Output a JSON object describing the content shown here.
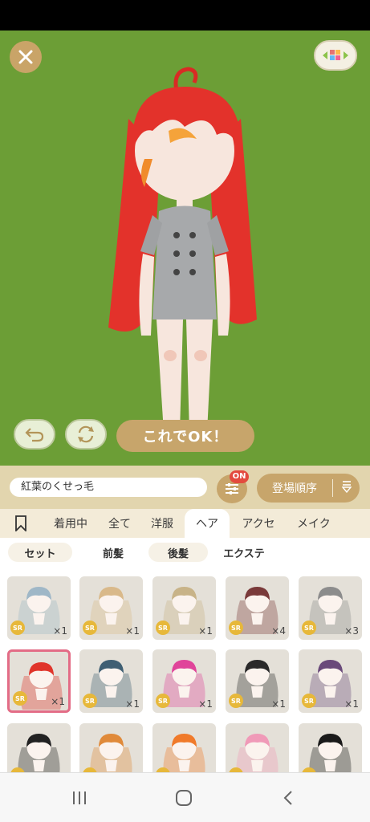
{
  "controls": {
    "ok_label": "これでOK！"
  },
  "item_name": "紅葉のくせっ毛",
  "filter_badge": "ON",
  "sort_label": "登場順序",
  "tabs": [
    {
      "label": "",
      "icon": "bookmark-icon"
    },
    {
      "label": "着用中"
    },
    {
      "label": "全て"
    },
    {
      "label": "洋服"
    },
    {
      "label": "ヘア",
      "active": true
    },
    {
      "label": "アクセ"
    },
    {
      "label": "メイク"
    }
  ],
  "subtabs": [
    {
      "label": "セット"
    },
    {
      "label": "前髪",
      "active": true
    },
    {
      "label": "後髪"
    },
    {
      "label": "エクステ"
    }
  ],
  "items": [
    {
      "rarity": "SR",
      "qty": "×1",
      "hair": "#9fb7c7"
    },
    {
      "rarity": "SR",
      "qty": "×1",
      "hair": "#d9b98a"
    },
    {
      "rarity": "SR",
      "qty": "×1",
      "hair": "#c8b388"
    },
    {
      "rarity": "SR",
      "qty": "×4",
      "hair": "#7a3a3a"
    },
    {
      "rarity": "SR",
      "qty": "×3",
      "hair": "#8c8c8c"
    },
    {
      "rarity": "SR",
      "qty": "×1",
      "hair": "#e0352b",
      "selected": true
    },
    {
      "rarity": "SR",
      "qty": "×1",
      "hair": "#3f5f73"
    },
    {
      "rarity": "SR",
      "qty": "×1",
      "hair": "#e0449a"
    },
    {
      "rarity": "SR",
      "qty": "×1",
      "hair": "#2a2a2a"
    },
    {
      "rarity": "SR",
      "qty": "×1",
      "hair": "#6a4a7a"
    },
    {
      "rarity": "SR",
      "qty": "",
      "hair": "#222222"
    },
    {
      "rarity": "SR",
      "qty": "",
      "hair": "#e08a3a"
    },
    {
      "rarity": "SR",
      "qty": "",
      "hair": "#f07a2a"
    },
    {
      "rarity": "SR",
      "qty": "",
      "hair": "#f09ab8"
    },
    {
      "rarity": "SR",
      "qty": "",
      "hair": "#1a1a1a"
    }
  ],
  "colors": {
    "stage_bg": "#6c9e36",
    "accent_gold": "#c7a56b",
    "panel_bg": "#e2d5ae",
    "badge_red": "#e34a3e",
    "selected_border": "#e36c86"
  }
}
